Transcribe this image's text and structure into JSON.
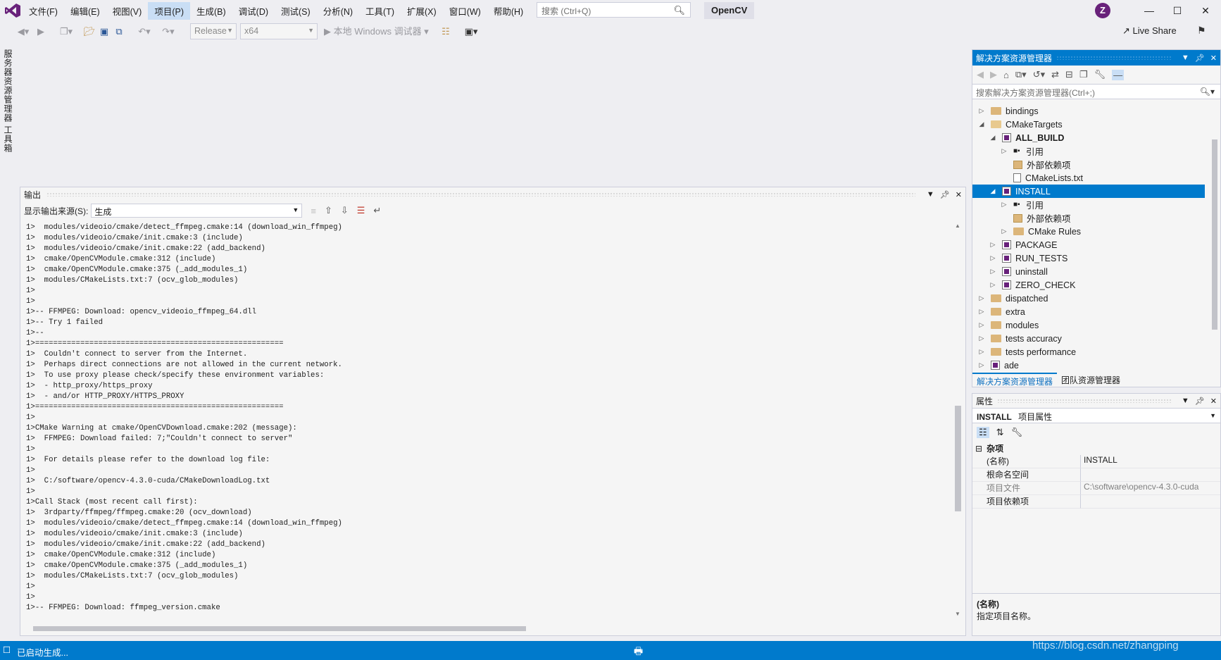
{
  "menu": [
    "文件(F)",
    "编辑(E)",
    "视图(V)",
    "项目(P)",
    "生成(B)",
    "调试(D)",
    "测试(S)",
    "分析(N)",
    "工具(T)",
    "扩展(X)",
    "窗口(W)",
    "帮助(H)"
  ],
  "search_placeholder": "搜索 (Ctrl+Q)",
  "solution_name": "OpenCV",
  "avatar_letter": "Z",
  "toolbar": {
    "config": "Release",
    "platform": "x64",
    "debugger": "本地 Windows 调试器"
  },
  "live_share": "Live Share",
  "left_tabs": [
    "服务器资源管理器",
    "工具箱"
  ],
  "output": {
    "title": "输出",
    "source_label": "显示输出来源(S):",
    "source_value": "生成",
    "text": "1>  modules/videoio/cmake/detect_ffmpeg.cmake:14 (download_win_ffmpeg)\n1>  modules/videoio/cmake/init.cmake:3 (include)\n1>  modules/videoio/cmake/init.cmake:22 (add_backend)\n1>  cmake/OpenCVModule.cmake:312 (include)\n1>  cmake/OpenCVModule.cmake:375 (_add_modules_1)\n1>  modules/CMakeLists.txt:7 (ocv_glob_modules)\n1>\n1>\n1>-- FFMPEG: Download: opencv_videoio_ffmpeg_64.dll\n1>-- Try 1 failed\n1>--\n1>=======================================================\n1>  Couldn't connect to server from the Internet.\n1>  Perhaps direct connections are not allowed in the current network.\n1>  To use proxy please check/specify these environment variables:\n1>  - http_proxy/https_proxy\n1>  - and/or HTTP_PROXY/HTTPS_PROXY\n1>=======================================================\n1>\n1>CMake Warning at cmake/OpenCVDownload.cmake:202 (message):\n1>  FFMPEG: Download failed: 7;\"Couldn't connect to server\"\n1>\n1>  For details please refer to the download log file:\n1>\n1>  C:/software/opencv-4.3.0-cuda/CMakeDownloadLog.txt\n1>\n1>Call Stack (most recent call first):\n1>  3rdparty/ffmpeg/ffmpeg.cmake:20 (ocv_download)\n1>  modules/videoio/cmake/detect_ffmpeg.cmake:14 (download_win_ffmpeg)\n1>  modules/videoio/cmake/init.cmake:3 (include)\n1>  modules/videoio/cmake/init.cmake:22 (add_backend)\n1>  cmake/OpenCVModule.cmake:312 (include)\n1>  cmake/OpenCVModule.cmake:375 (_add_modules_1)\n1>  modules/CMakeLists.txt:7 (ocv_glob_modules)\n1>\n1>\n1>-- FFMPEG: Download: ffmpeg_version.cmake"
  },
  "solution_explorer": {
    "title": "解决方案资源管理器",
    "search_placeholder": "搜索解决方案资源管理器(Ctrl+;)",
    "tree": [
      {
        "label": "bindings",
        "icon": "folder-icon",
        "level": 0,
        "expand": "collapsed"
      },
      {
        "label": "CMakeTargets",
        "icon": "folder-open-icon",
        "level": 0,
        "expand": "expanded"
      },
      {
        "label": "ALL_BUILD",
        "icon": "project-icon",
        "level": 1,
        "expand": "expanded",
        "bold": true
      },
      {
        "label": "引用",
        "icon": "references-icon",
        "level": 2,
        "expand": "collapsed"
      },
      {
        "label": "外部依赖项",
        "icon": "external-deps-icon",
        "level": 2,
        "expand": "none"
      },
      {
        "label": "CMakeLists.txt",
        "icon": "file-icon",
        "level": 2,
        "expand": "none"
      },
      {
        "label": "INSTALL",
        "icon": "project-icon",
        "level": 1,
        "expand": "expanded",
        "selected": true
      },
      {
        "label": "引用",
        "icon": "references-icon",
        "level": 2,
        "expand": "collapsed"
      },
      {
        "label": "外部依赖项",
        "icon": "external-deps-icon",
        "level": 2,
        "expand": "none"
      },
      {
        "label": "CMake Rules",
        "icon": "folder-icon",
        "level": 2,
        "expand": "collapsed"
      },
      {
        "label": "PACKAGE",
        "icon": "project-icon",
        "level": 1,
        "expand": "collapsed"
      },
      {
        "label": "RUN_TESTS",
        "icon": "project-icon",
        "level": 1,
        "expand": "collapsed"
      },
      {
        "label": "uninstall",
        "icon": "project-icon",
        "level": 1,
        "expand": "collapsed"
      },
      {
        "label": "ZERO_CHECK",
        "icon": "project-icon",
        "level": 1,
        "expand": "collapsed"
      },
      {
        "label": "dispatched",
        "icon": "folder-icon",
        "level": 0,
        "expand": "collapsed"
      },
      {
        "label": "extra",
        "icon": "folder-icon",
        "level": 0,
        "expand": "collapsed"
      },
      {
        "label": "modules",
        "icon": "folder-icon",
        "level": 0,
        "expand": "collapsed"
      },
      {
        "label": "tests accuracy",
        "icon": "folder-icon",
        "level": 0,
        "expand": "collapsed"
      },
      {
        "label": "tests performance",
        "icon": "folder-icon",
        "level": 0,
        "expand": "collapsed"
      },
      {
        "label": "ade",
        "icon": "project-icon",
        "level": 0,
        "expand": "collapsed"
      }
    ],
    "tabs": [
      "解决方案资源管理器",
      "团队资源管理器"
    ]
  },
  "properties": {
    "title": "属性",
    "object_name": "INSTALL",
    "object_type": "项目属性",
    "group": "杂项",
    "rows": [
      {
        "key": "(名称)",
        "value": "INSTALL"
      },
      {
        "key": "根命名空间",
        "value": ""
      },
      {
        "key": "项目文件",
        "value": "C:\\software\\opencv-4.3.0-cuda"
      },
      {
        "key": "项目依赖项",
        "value": ""
      }
    ],
    "desc_title": "(名称)",
    "desc_text": "指定项目名称。"
  },
  "status": {
    "text": "已启动生成..."
  },
  "watermark": "https://blog.csdn.net/zhangping"
}
